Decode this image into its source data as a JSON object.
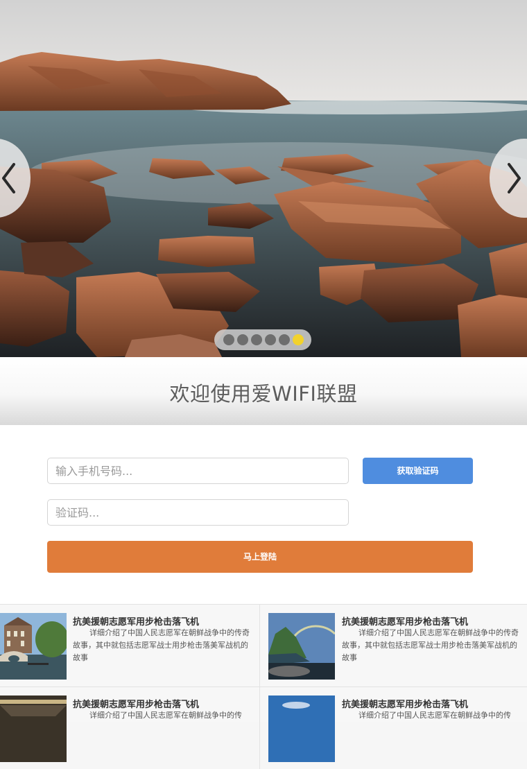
{
  "carousel": {
    "prev_icon": "chevron-left-icon",
    "next_icon": "chevron-right-icon",
    "dot_count": 6,
    "active_dot": 6,
    "colors": {
      "dot": "#6e6e6e",
      "active_dot": "#f2d22c"
    }
  },
  "welcome": {
    "title": "欢迎使用爱WIFI联盟"
  },
  "form": {
    "phone_placeholder": "输入手机号码...",
    "code_placeholder": "验证码...",
    "get_code_label": "获取验证码",
    "login_label": "马上登陆",
    "colors": {
      "get_code": "#4f8ddf",
      "login": "#e07c3a"
    }
  },
  "news": {
    "items": [
      {
        "title": "抗美援朝志愿军用步枪击落飞机",
        "desc": "详细介绍了中国人民志愿军在朝鲜战争中的传奇故事，其中就包括志愿军战士用步枪击落美军战机的故事"
      },
      {
        "title": "抗美援朝志愿军用步枪击落飞机",
        "desc": "详细介绍了中国人民志愿军在朝鲜战争中的传奇故事，其中就包括志愿军战士用步枪击落美军战机的故事"
      },
      {
        "title": "抗美援朝志愿军用步枪击落飞机",
        "desc": "详细介绍了中国人民志愿军在朝鲜战争中的传"
      },
      {
        "title": "抗美援朝志愿军用步枪击落飞机",
        "desc": "详细介绍了中国人民志愿军在朝鲜战争中的传"
      }
    ]
  }
}
